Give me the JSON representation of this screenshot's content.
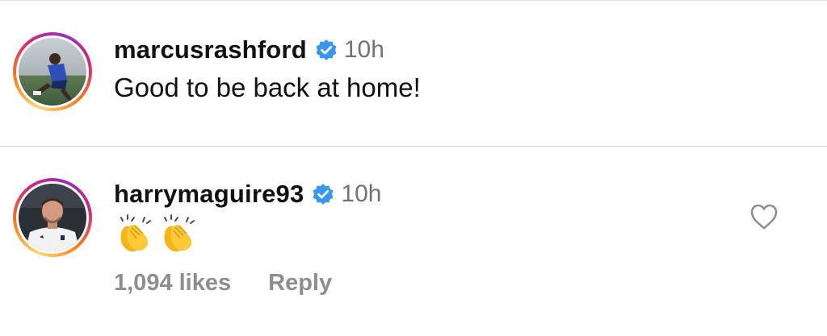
{
  "comments": [
    {
      "username": "marcusrashford",
      "verified": true,
      "time": "10h",
      "text": "Good to be back at home!"
    },
    {
      "username": "harrymaguire93",
      "verified": true,
      "time": "10h",
      "text": "👏👏",
      "likes": "1,094 likes",
      "reply_label": "Reply"
    }
  ],
  "icons": {
    "verified": "verified-badge-icon",
    "like": "heart-outline-icon",
    "emoji": "clapping-hands-emoji"
  },
  "colors": {
    "verified_blue": "#3897f0",
    "timestamp_gray": "#737373",
    "action_gray": "#8e8e8e",
    "divider": "#dbdbdb"
  }
}
